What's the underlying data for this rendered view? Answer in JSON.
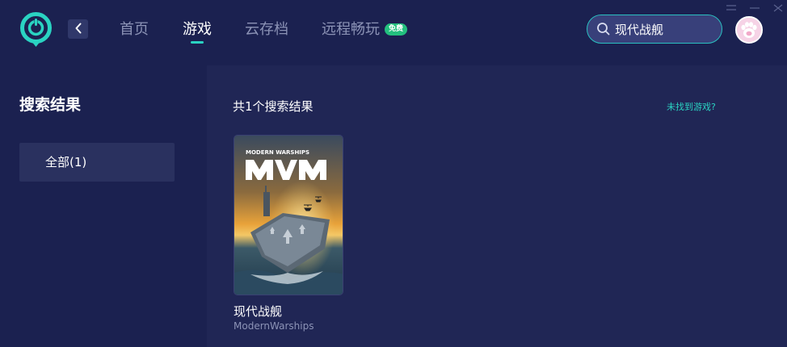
{
  "header": {
    "nav": [
      {
        "label": "首页"
      },
      {
        "label": "游戏"
      },
      {
        "label": "云存档"
      },
      {
        "label": "远程畅玩"
      }
    ],
    "free_badge": "免费",
    "search": {
      "value": "现代战舰"
    },
    "icons": {
      "logo": "app-logo-icon",
      "back": "chevron-left-icon",
      "search": "search-icon",
      "avatar": "cat-paw-avatar",
      "menu": "menu-icon",
      "minimize": "minimize-icon"
    }
  },
  "sidebar": {
    "title": "搜索结果",
    "filters": [
      {
        "label": "全部(1)"
      }
    ]
  },
  "main": {
    "result_count": "共1个搜索结果",
    "not_found_link": "未找到游戏?",
    "results": [
      {
        "name": "现代战舰",
        "subtitle": "ModernWarships",
        "cover_text": "MODERN WARSHIPS"
      }
    ]
  },
  "colors": {
    "accent": "#2ad3c2",
    "background": "#1b2150",
    "panel": "#202655",
    "badge": "#23c07e"
  }
}
